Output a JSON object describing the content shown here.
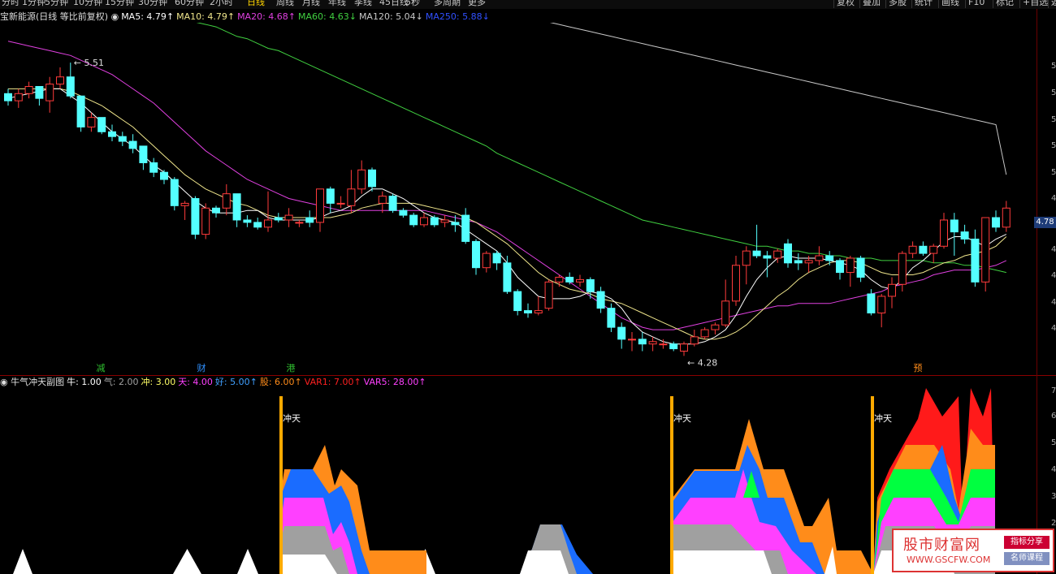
{
  "toolbar": {
    "periods": [
      "分时",
      "1分钟",
      "5分钟",
      "10分钟",
      "15分钟",
      "30分钟",
      "60分钟",
      "2小时",
      "日线",
      "周线",
      "月线",
      "年线",
      "季线",
      "45日线",
      "5秒",
      "多周期",
      "更多"
    ],
    "active_period": "日线",
    "right": [
      "复权",
      "叠加",
      "多股",
      "统计",
      "画线",
      "F10",
      "标记",
      "+自选",
      "返"
    ]
  },
  "legend_main": {
    "stock": "宝新能源(日线 等比前复权)",
    "items": [
      {
        "text": "MA5: 4.79↑",
        "color": "#ffffff"
      },
      {
        "text": "MA10: 4.79↑",
        "color": "#f0e68c"
      },
      {
        "text": "MA20: 4.68↑",
        "color": "#e040e0"
      },
      {
        "text": "MA60: 4.63↓",
        "color": "#40d040"
      },
      {
        "text": "MA120: 5.04↓",
        "color": "#c8c8c8"
      },
      {
        "text": "MA250: 5.88↓",
        "color": "#3050ff"
      }
    ]
  },
  "legend_sub": {
    "title": "牛气冲天副图",
    "items": [
      {
        "text": "牛: 1.00",
        "color": "#ffffff"
      },
      {
        "text": "气: 2.00",
        "color": "#a0a0a0"
      },
      {
        "text": "冲: 3.00",
        "color": "#ffff66"
      },
      {
        "text": "天: 4.00",
        "color": "#ff40ff"
      },
      {
        "text": "好: 5.00↑",
        "color": "#40a0ff"
      },
      {
        "text": "股: 6.00↑",
        "color": "#ff8c1a"
      },
      {
        "text": "VAR1: 7.00↑",
        "color": "#ff2020"
      },
      {
        "text": "VAR5: 28.00↑",
        "color": "#ff40ff"
      }
    ]
  },
  "price": {
    "current": "4.78",
    "high_label": "5.51",
    "low_label": "4.28",
    "markers": [
      {
        "t": "减",
        "color": "#30c030",
        "c": 0
      },
      {
        "t": "财",
        "color": "#3090ff",
        "c": 1
      },
      {
        "t": "港",
        "color": "#30c030",
        "c": 2
      },
      {
        "t": "预",
        "color": "#ff8c1a",
        "c": 3
      }
    ]
  },
  "axis_ticks": [
    "5",
    "5",
    "5",
    "5",
    "5",
    "4",
    "4",
    "4",
    "4",
    "4",
    "7",
    "6",
    "5",
    "4",
    "3",
    "2"
  ],
  "signal_label": "冲天",
  "colors": {
    "up": "#ff3b3b",
    "down": "#54ffff",
    "ma5": "#ffffff",
    "ma10": "#f0e68c",
    "ma20": "#e040e0",
    "ma60": "#40d040",
    "ma120": "#c8c8c8",
    "signal": "#ffaa00"
  },
  "chart_data": {
    "type": "candlestick",
    "candles_ohlc": [
      [
        5.38,
        5.4,
        5.33,
        5.35
      ],
      [
        5.35,
        5.4,
        5.32,
        5.38
      ],
      [
        5.38,
        5.43,
        5.36,
        5.41
      ],
      [
        5.41,
        5.41,
        5.33,
        5.36
      ],
      [
        5.35,
        5.45,
        5.3,
        5.42
      ],
      [
        5.42,
        5.49,
        5.4,
        5.45
      ],
      [
        5.45,
        5.51,
        5.36,
        5.37
      ],
      [
        5.37,
        5.37,
        5.22,
        5.24
      ],
      [
        5.24,
        5.3,
        5.22,
        5.28
      ],
      [
        5.28,
        5.28,
        5.21,
        5.22
      ],
      [
        5.22,
        5.25,
        5.18,
        5.2
      ],
      [
        5.2,
        5.22,
        5.16,
        5.18
      ],
      [
        5.18,
        5.21,
        5.13,
        5.15
      ],
      [
        5.16,
        5.16,
        5.06,
        5.09
      ],
      [
        5.09,
        5.11,
        5.03,
        5.05
      ],
      [
        5.05,
        5.06,
        5.0,
        5.02
      ],
      [
        5.02,
        5.03,
        4.89,
        4.91
      ],
      [
        4.91,
        4.93,
        4.85,
        4.92
      ],
      [
        4.94,
        4.95,
        4.77,
        4.79
      ],
      [
        4.79,
        4.92,
        4.77,
        4.9
      ],
      [
        4.9,
        4.91,
        4.86,
        4.88
      ],
      [
        4.9,
        5.0,
        4.87,
        4.96
      ],
      [
        4.96,
        4.96,
        4.82,
        4.85
      ],
      [
        4.85,
        4.87,
        4.82,
        4.84
      ],
      [
        4.84,
        4.86,
        4.81,
        4.82
      ],
      [
        4.82,
        4.97,
        4.8,
        4.85
      ],
      [
        4.86,
        4.88,
        4.84,
        4.85
      ],
      [
        4.85,
        4.9,
        4.82,
        4.87
      ],
      [
        4.84,
        4.85,
        4.82,
        4.84
      ],
      [
        4.86,
        4.89,
        4.82,
        4.84
      ],
      [
        4.84,
        4.95,
        4.8,
        4.98
      ],
      [
        4.98,
        4.99,
        4.88,
        4.92
      ],
      [
        4.92,
        4.95,
        4.9,
        4.92
      ],
      [
        4.91,
        5.06,
        4.88,
        4.98
      ],
      [
        4.98,
        5.1,
        4.96,
        5.06
      ],
      [
        5.06,
        5.07,
        4.97,
        4.99
      ],
      [
        4.92,
        4.97,
        4.88,
        4.95
      ],
      [
        4.95,
        4.96,
        4.88,
        4.89
      ],
      [
        4.89,
        4.9,
        4.86,
        4.87
      ],
      [
        4.87,
        4.88,
        4.82,
        4.83
      ],
      [
        4.83,
        4.88,
        4.82,
        4.86
      ],
      [
        4.86,
        4.87,
        4.82,
        4.83
      ],
      [
        4.84,
        4.87,
        4.82,
        4.85
      ],
      [
        4.84,
        4.87,
        4.8,
        4.83
      ],
      [
        4.87,
        4.9,
        4.75,
        4.76
      ],
      [
        4.76,
        4.77,
        4.62,
        4.65
      ],
      [
        4.65,
        4.72,
        4.63,
        4.71
      ],
      [
        4.71,
        4.72,
        4.64,
        4.67
      ],
      [
        4.67,
        4.7,
        4.54,
        4.55
      ],
      [
        4.55,
        4.56,
        4.45,
        4.47
      ],
      [
        4.47,
        4.5,
        4.44,
        4.46
      ],
      [
        4.46,
        4.53,
        4.45,
        4.47
      ],
      [
        4.48,
        4.6,
        4.47,
        4.59
      ],
      [
        4.59,
        4.62,
        4.57,
        4.61
      ],
      [
        4.61,
        4.63,
        4.58,
        4.59
      ],
      [
        4.59,
        4.62,
        4.57,
        4.6
      ],
      [
        4.6,
        4.61,
        4.52,
        4.55
      ],
      [
        4.55,
        4.57,
        4.46,
        4.48
      ],
      [
        4.48,
        4.5,
        4.38,
        4.4
      ],
      [
        4.4,
        4.42,
        4.31,
        4.35
      ],
      [
        4.35,
        4.38,
        4.3,
        4.35
      ],
      [
        4.35,
        4.38,
        4.3,
        4.33
      ],
      [
        4.33,
        4.36,
        4.3,
        4.34
      ],
      [
        4.33,
        4.35,
        4.31,
        4.33
      ],
      [
        4.33,
        4.34,
        4.3,
        4.31
      ],
      [
        4.3,
        4.34,
        4.28,
        4.33
      ],
      [
        4.33,
        4.39,
        4.32,
        4.36
      ],
      [
        4.36,
        4.4,
        4.35,
        4.39
      ],
      [
        4.39,
        4.42,
        4.37,
        4.41
      ],
      [
        4.41,
        4.6,
        4.4,
        4.51
      ],
      [
        4.51,
        4.7,
        4.49,
        4.66
      ],
      [
        4.66,
        4.74,
        4.58,
        4.72
      ],
      [
        4.72,
        4.83,
        4.69,
        4.7
      ],
      [
        4.7,
        4.72,
        4.61,
        4.69
      ],
      [
        4.69,
        4.73,
        4.67,
        4.72
      ],
      [
        4.75,
        4.77,
        4.65,
        4.67
      ],
      [
        4.68,
        4.71,
        4.64,
        4.67
      ],
      [
        4.67,
        4.7,
        4.63,
        4.68
      ],
      [
        4.68,
        4.74,
        4.66,
        4.7
      ],
      [
        4.7,
        4.72,
        4.66,
        4.68
      ],
      [
        4.68,
        4.69,
        4.6,
        4.63
      ],
      [
        4.63,
        4.7,
        4.57,
        4.69
      ],
      [
        4.69,
        4.7,
        4.59,
        4.61
      ],
      [
        4.54,
        4.56,
        4.45,
        4.46
      ],
      [
        4.46,
        4.54,
        4.4,
        4.53
      ],
      [
        4.53,
        4.61,
        4.48,
        4.58
      ],
      [
        4.58,
        4.72,
        4.55,
        4.71
      ],
      [
        4.71,
        4.76,
        4.69,
        4.74
      ],
      [
        4.74,
        4.76,
        4.7,
        4.71
      ],
      [
        4.71,
        4.75,
        4.67,
        4.74
      ],
      [
        4.74,
        4.88,
        4.73,
        4.85
      ],
      [
        4.85,
        4.88,
        4.7,
        4.8
      ],
      [
        4.8,
        4.83,
        4.75,
        4.77
      ],
      [
        4.77,
        4.81,
        4.57,
        4.59
      ],
      [
        4.59,
        4.85,
        4.55,
        4.86
      ],
      [
        4.86,
        4.89,
        4.8,
        4.82
      ],
      [
        4.82,
        4.93,
        4.8,
        4.9
      ]
    ],
    "ma5": [
      5.36,
      5.37,
      5.38,
      5.39,
      5.4,
      5.4,
      5.37,
      5.34,
      5.3,
      5.26,
      5.22,
      5.19,
      5.16,
      5.12,
      5.08,
      5.05,
      5.01,
      4.97,
      4.93,
      4.9,
      4.88,
      4.88,
      4.88,
      4.89,
      4.89,
      4.86,
      4.85,
      4.85,
      4.85,
      4.85,
      4.86,
      4.88,
      4.89,
      4.91,
      4.95,
      4.98,
      4.98,
      4.96,
      4.94,
      4.91,
      4.88,
      4.86,
      4.85,
      4.84,
      4.81,
      4.78,
      4.75,
      4.72,
      4.67,
      4.61,
      4.57,
      4.53,
      4.52,
      4.52,
      4.52,
      4.53,
      4.55,
      4.54,
      4.52,
      4.48,
      4.42,
      4.38,
      4.36,
      4.34,
      4.33,
      4.33,
      4.33,
      4.34,
      4.36,
      4.39,
      4.45,
      4.53,
      4.6,
      4.65,
      4.69,
      4.7,
      4.69,
      4.69,
      4.69,
      4.68,
      4.67,
      4.66,
      4.64,
      4.6,
      4.57,
      4.56,
      4.6,
      4.65,
      4.68,
      4.72,
      4.76,
      4.78,
      4.78,
      4.76,
      4.74,
      4.77,
      4.79
    ],
    "ma10": [
      5.4,
      5.4,
      5.4,
      5.4,
      5.4,
      5.4,
      5.39,
      5.37,
      5.35,
      5.33,
      5.3,
      5.27,
      5.24,
      5.2,
      5.16,
      5.12,
      5.08,
      5.04,
      5.01,
      4.98,
      4.96,
      4.94,
      4.92,
      4.91,
      4.89,
      4.87,
      4.86,
      4.86,
      4.86,
      4.86,
      4.86,
      4.86,
      4.87,
      4.88,
      4.9,
      4.91,
      4.92,
      4.92,
      4.92,
      4.92,
      4.91,
      4.9,
      4.89,
      4.88,
      4.86,
      4.84,
      4.81,
      4.78,
      4.75,
      4.71,
      4.67,
      4.63,
      4.6,
      4.58,
      4.56,
      4.55,
      4.54,
      4.52,
      4.51,
      4.5,
      4.48,
      4.46,
      4.44,
      4.42,
      4.4,
      4.38,
      4.36,
      4.35,
      4.35,
      4.36,
      4.38,
      4.41,
      4.45,
      4.49,
      4.53,
      4.56,
      4.6,
      4.63,
      4.65,
      4.67,
      4.68,
      4.68,
      4.67,
      4.65,
      4.63,
      4.62,
      4.62,
      4.62,
      4.63,
      4.65,
      4.67,
      4.68,
      4.7,
      4.71,
      4.72,
      4.74,
      4.78
    ],
    "ma20": [
      5.6,
      5.59,
      5.58,
      5.57,
      5.56,
      5.55,
      5.54,
      5.52,
      5.5,
      5.48,
      5.46,
      5.43,
      5.4,
      5.37,
      5.34,
      5.3,
      5.26,
      5.22,
      5.18,
      5.14,
      5.11,
      5.08,
      5.05,
      5.02,
      5.0,
      4.98,
      4.96,
      4.94,
      4.93,
      4.92,
      4.91,
      4.9,
      4.89,
      4.89,
      4.89,
      4.89,
      4.89,
      4.89,
      4.89,
      4.89,
      4.89,
      4.88,
      4.87,
      4.86,
      4.85,
      4.84,
      4.82,
      4.8,
      4.77,
      4.74,
      4.71,
      4.68,
      4.65,
      4.62,
      4.59,
      4.56,
      4.53,
      4.5,
      4.47,
      4.44,
      4.42,
      4.4,
      4.39,
      4.39,
      4.39,
      4.4,
      4.41,
      4.42,
      4.43,
      4.44,
      4.45,
      4.46,
      4.47,
      4.48,
      4.49,
      4.49,
      4.5,
      4.5,
      4.5,
      4.5,
      4.51,
      4.52,
      4.53,
      4.54,
      4.55,
      4.57,
      4.58,
      4.59,
      4.6,
      4.62,
      4.63,
      4.64,
      4.64,
      4.64,
      4.65,
      4.66,
      4.68
    ],
    "ma60": [
      5.9,
      5.89,
      5.88,
      5.87,
      5.86,
      5.85,
      5.84,
      5.83,
      5.81,
      5.8,
      5.79,
      5.78,
      5.77,
      5.75,
      5.74,
      5.73,
      5.71,
      5.7,
      5.68,
      5.67,
      5.66,
      5.64,
      5.62,
      5.61,
      5.59,
      5.57,
      5.56,
      5.54,
      5.52,
      5.5,
      5.48,
      5.46,
      5.44,
      5.42,
      5.4,
      5.38,
      5.36,
      5.34,
      5.32,
      5.3,
      5.28,
      5.26,
      5.24,
      5.22,
      5.2,
      5.18,
      5.16,
      5.13,
      5.11,
      5.09,
      5.07,
      5.05,
      5.03,
      5.01,
      4.99,
      4.97,
      4.95,
      4.93,
      4.91,
      4.89,
      4.87,
      4.85,
      4.84,
      4.83,
      4.82,
      4.81,
      4.8,
      4.79,
      4.78,
      4.77,
      4.76,
      4.75,
      4.74,
      4.74,
      4.73,
      4.72,
      4.72,
      4.71,
      4.71,
      4.7,
      4.7,
      4.69,
      4.69,
      4.69,
      4.68,
      4.68,
      4.68,
      4.68,
      4.68,
      4.67,
      4.67,
      4.67,
      4.66,
      4.66,
      4.65,
      4.64,
      4.63
    ],
    "ma120": [
      6.2,
      6.19,
      6.18,
      6.17,
      6.16,
      6.15,
      6.14,
      6.13,
      6.12,
      6.11,
      6.1,
      6.09,
      6.08,
      6.07,
      6.06,
      6.05,
      6.04,
      6.03,
      6.02,
      6.01,
      6.0,
      5.99,
      5.98,
      5.97,
      5.96,
      5.95,
      5.94,
      5.93,
      5.92,
      5.91,
      5.9,
      5.89,
      5.88,
      5.87,
      5.86,
      5.85,
      5.84,
      5.83,
      5.82,
      5.81,
      5.8,
      5.79,
      5.78,
      5.77,
      5.76,
      5.75,
      5.74,
      5.73,
      5.72,
      5.71,
      5.7,
      5.69,
      5.68,
      5.67,
      5.66,
      5.65,
      5.64,
      5.63,
      5.62,
      5.61,
      5.6,
      5.59,
      5.58,
      5.57,
      5.56,
      5.55,
      5.54,
      5.53,
      5.52,
      5.51,
      5.5,
      5.49,
      5.48,
      5.47,
      5.46,
      5.45,
      5.44,
      5.43,
      5.42,
      5.41,
      5.4,
      5.39,
      5.38,
      5.37,
      5.36,
      5.35,
      5.34,
      5.33,
      5.32,
      5.31,
      5.3,
      5.29,
      5.28,
      5.27,
      5.26,
      5.25,
      5.04
    ],
    "indicator_levels": [
      0,
      0,
      0,
      0,
      0,
      0,
      0,
      0,
      0,
      0,
      0,
      0,
      0,
      0,
      0,
      0,
      0,
      0,
      0,
      0,
      0,
      0,
      0,
      0,
      0,
      0,
      0,
      0,
      0,
      0,
      0,
      0,
      0,
      0,
      0,
      0,
      0,
      0,
      0,
      0,
      0,
      0,
      0,
      0,
      0,
      0,
      0,
      0,
      0,
      0,
      0,
      0,
      0,
      0,
      0,
      0,
      0,
      0,
      0,
      0,
      0,
      0,
      0,
      0,
      0,
      0,
      0,
      0,
      0,
      0,
      0,
      0,
      0,
      0,
      0,
      0,
      0,
      0,
      0,
      0,
      0,
      0,
      0,
      0,
      0,
      0,
      0,
      0,
      0,
      0,
      0,
      0,
      0,
      0,
      0,
      0,
      0
    ]
  }
}
